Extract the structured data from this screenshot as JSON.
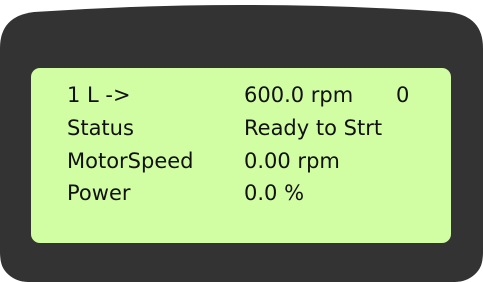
{
  "display": {
    "rows": [
      {
        "label": "1 L ->",
        "value": "600.0 rpm",
        "extra": "0"
      },
      {
        "label": "Status",
        "value": "Ready to Strt"
      },
      {
        "label": "MotorSpeed",
        "value": "0.00 rpm"
      },
      {
        "label": "Power",
        "value": "0.0 %"
      }
    ]
  }
}
